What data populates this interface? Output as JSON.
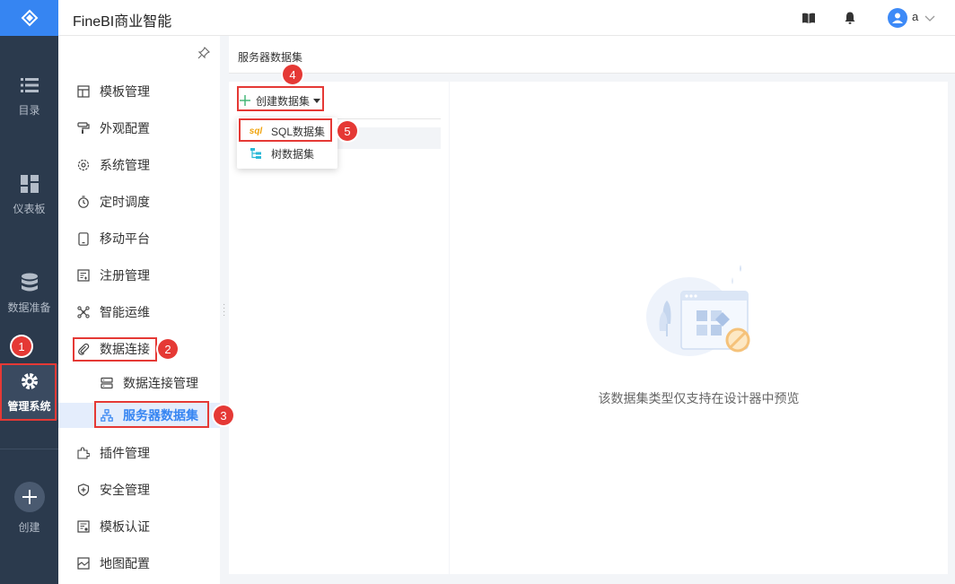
{
  "app": {
    "title": "FineBI商业智能",
    "user": "a"
  },
  "rail": {
    "items": [
      {
        "label": "目录",
        "icon": "list-icon"
      },
      {
        "label": "仪表板",
        "icon": "dashboard-icon"
      },
      {
        "label": "数据准备",
        "icon": "database-icon"
      },
      {
        "label": "管理系统",
        "icon": "gear-icon"
      },
      {
        "label": "创建",
        "icon": "plus-icon"
      }
    ]
  },
  "sidebar": {
    "items": [
      {
        "label": "模板管理"
      },
      {
        "label": "外观配置"
      },
      {
        "label": "系统管理"
      },
      {
        "label": "定时调度"
      },
      {
        "label": "移动平台"
      },
      {
        "label": "注册管理"
      },
      {
        "label": "智能运维"
      },
      {
        "label": "数据连接"
      },
      {
        "label": "数据连接管理"
      },
      {
        "label": "服务器数据集"
      },
      {
        "label": "插件管理"
      },
      {
        "label": "安全管理"
      },
      {
        "label": "模板认证"
      },
      {
        "label": "地图配置"
      }
    ]
  },
  "content": {
    "breadcrumb": "服务器数据集",
    "create_button": "创建数据集",
    "dropdown": [
      {
        "label": "SQL数据集",
        "icon_text": "sql"
      },
      {
        "label": "树数据集"
      }
    ],
    "empty_text": "该数据集类型仅支持在设计器中预览"
  },
  "annotations": [
    "1",
    "2",
    "3",
    "4",
    "5"
  ],
  "colors": {
    "accent": "#3685f2",
    "rail": "#2b3a4d",
    "highlight": "#e53935"
  }
}
